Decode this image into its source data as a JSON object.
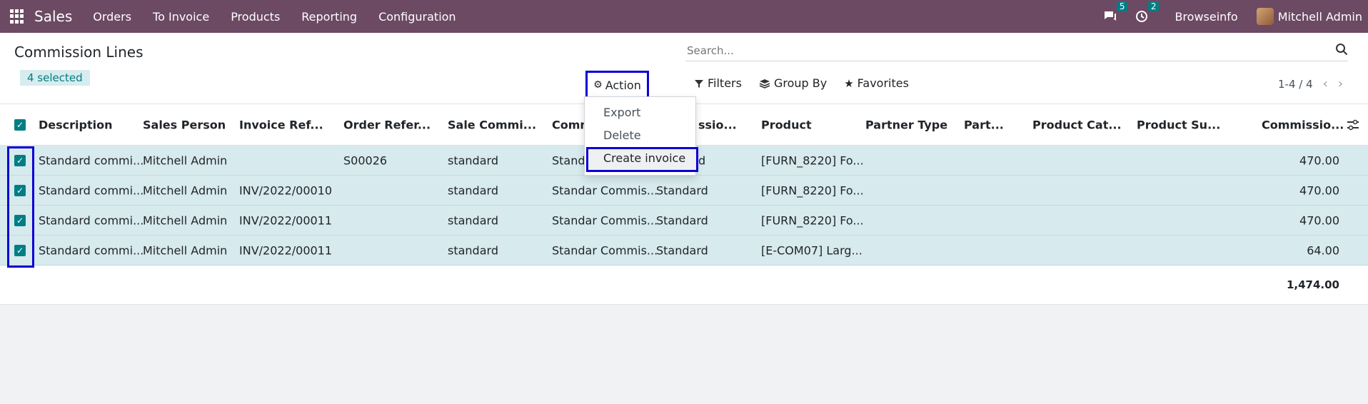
{
  "navbar": {
    "app_name": "Sales",
    "menu": [
      "Orders",
      "To Invoice",
      "Products",
      "Reporting",
      "Configuration"
    ],
    "messages_count": "5",
    "activities_count": "2",
    "company": "Browseinfo",
    "user": "Mitchell Admin"
  },
  "control": {
    "title": "Commission Lines",
    "selected": "4 selected",
    "action_label": "Action",
    "search_placeholder": "Search...",
    "filters_label": "Filters",
    "groupby_label": "Group By",
    "favorites_label": "Favorites",
    "pager": "1-4 / 4"
  },
  "dropdown": {
    "export": "Export",
    "delete": "Delete",
    "create_invoice": "Create invoice"
  },
  "table": {
    "headers": [
      "Description",
      "Sales Person",
      "Invoice Ref...",
      "Order Refer...",
      "Sale Commi...",
      "Comm",
      "ssio...",
      "Product",
      "Partner Type",
      "Part...",
      "Product Cat...",
      "Product Su...",
      "Commissio..."
    ],
    "rows": [
      {
        "desc": "Standard commi...",
        "sp": "Mitchell Admin",
        "inv": "",
        "order": "S00026",
        "sale": "standard",
        "comm": "Standa",
        "type": "d",
        "product": "[FURN_8220] Fo...",
        "amount": "470.00"
      },
      {
        "desc": "Standard commi...",
        "sp": "Mitchell Admin",
        "inv": "INV/2022/00010",
        "order": "",
        "sale": "standard",
        "comm": "Standar Commis...",
        "type": "Standard",
        "product": "[FURN_8220] Fo...",
        "amount": "470.00"
      },
      {
        "desc": "Standard commi...",
        "sp": "Mitchell Admin",
        "inv": "INV/2022/00011",
        "order": "",
        "sale": "standard",
        "comm": "Standar Commis...",
        "type": "Standard",
        "product": "[FURN_8220] Fo...",
        "amount": "470.00"
      },
      {
        "desc": "Standard commi...",
        "sp": "Mitchell Admin",
        "inv": "INV/2022/00011",
        "order": "",
        "sale": "standard",
        "comm": "Standar Commis...",
        "type": "Standard",
        "product": "[E-COM07] Larg...",
        "amount": "64.00"
      }
    ],
    "total": "1,474.00"
  }
}
